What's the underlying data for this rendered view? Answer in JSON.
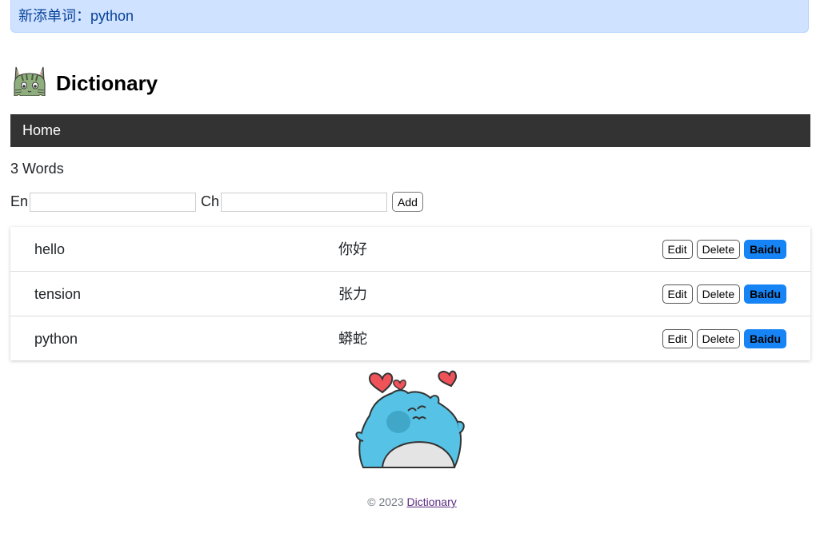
{
  "flash": {
    "message": "新添单词：python"
  },
  "header": {
    "title": "Dictionary",
    "logo_icon": "cat-icon"
  },
  "nav": {
    "home_label": "Home"
  },
  "summary": {
    "count_text": "3 Words"
  },
  "form": {
    "en_label": "En",
    "ch_label": "Ch",
    "en_value": "",
    "ch_value": "",
    "add_label": "Add"
  },
  "words": [
    {
      "en": "hello",
      "ch": "你好"
    },
    {
      "en": "tension",
      "ch": "张力"
    },
    {
      "en": "python",
      "ch": "蟒蛇"
    }
  ],
  "actions": {
    "edit_label": "Edit",
    "delete_label": "Delete",
    "baidu_label": "Baidu"
  },
  "footer": {
    "copyright": "© 2023",
    "link_text": "Dictionary"
  },
  "colors": {
    "baidu": "#1684f4",
    "nav": "#333333",
    "flash_bg": "#cfe2ff",
    "flash_text": "#084298"
  }
}
